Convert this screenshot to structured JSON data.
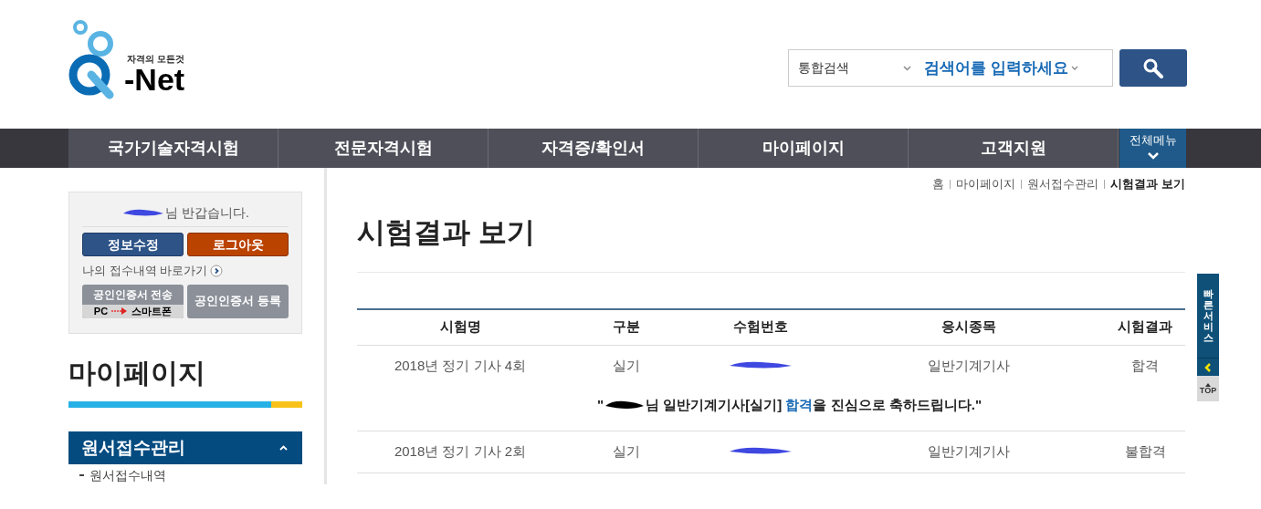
{
  "logo": {
    "tagline": "자격의 모든것",
    "name": "-Net"
  },
  "search": {
    "category": "통합검색",
    "placeholder": "검색어를 입력하세요"
  },
  "nav": {
    "items": [
      "국가기술자격시험",
      "전문자격시험",
      "자격증/확인서",
      "마이페이지",
      "고객지원"
    ],
    "all_menu": "전체메뉴"
  },
  "user_box": {
    "greeting": "님 반갑습니다.",
    "buttons": [
      {
        "label": "정보수정",
        "kind": "primary"
      },
      {
        "label": "로그아웃",
        "kind": "danger"
      }
    ],
    "history_link": "나의 접수내역 바로가기",
    "cert_send": {
      "label": "공인인증서 전송",
      "from": "PC",
      "to": "스마트폰"
    },
    "cert_register": "공인인증서 등록"
  },
  "sidebar": {
    "title": "마이페이지",
    "section": {
      "label": "원서접수관리",
      "expanded": true,
      "children": [
        "원서접수내역"
      ]
    }
  },
  "breadcrumb": [
    "홈",
    "마이페이지",
    "원서접수관리",
    "시험결과 보기"
  ],
  "page_title": "시험결과 보기",
  "table": {
    "columns": [
      "시험명",
      "구분",
      "수험번호",
      "응시종목",
      "시험결과"
    ],
    "rows": [
      {
        "exam": "2018년 정기 기사 4회",
        "type": "실기",
        "subject": "일반기계기사",
        "result": "합격",
        "message": {
          "open": "\"",
          "before": "님 일반기계기사[실기] ",
          "highlight": "합격",
          "after": "을 진심으로 축하드립니다.\""
        }
      },
      {
        "exam": "2018년 정기 기사 2회",
        "type": "실기",
        "subject": "일반기계기사",
        "result": "불합격"
      }
    ]
  },
  "quick": {
    "label": "빠른서비스",
    "top": "TOP"
  }
}
